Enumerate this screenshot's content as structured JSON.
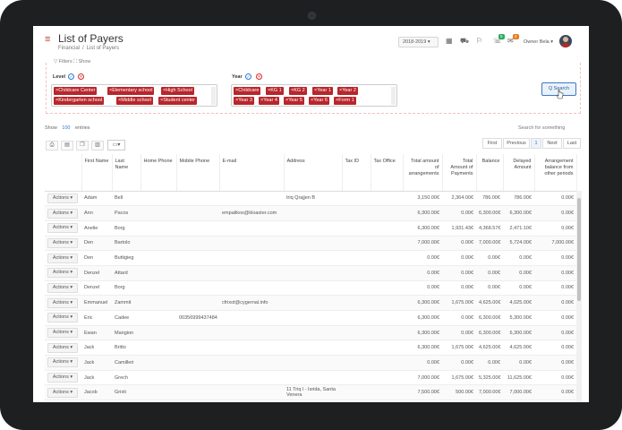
{
  "header": {
    "title": "List of Payers",
    "breadcrumb": [
      "Financial",
      "/",
      "List of Payers"
    ],
    "year": "2018-2019 ▾",
    "badge_notifications": "5",
    "badge_tasks": "4",
    "user_name": "Owner Bela ▾"
  },
  "filters": {
    "toggle_label": "▽ Filters ⛶ Show",
    "level": {
      "label": "Level",
      "tags": [
        "×Childcare Center",
        "×Elementary school",
        "×High School",
        "×Kindergarten school",
        "×Middle school",
        "×Student center"
      ]
    },
    "year": {
      "label": "Year",
      "tags": [
        "×Childcare",
        "×KG 1",
        "×KG 2",
        "×Year 1",
        "×Year 2",
        "×Year 3",
        "×Year 4",
        "×Year 5",
        "×Year 6",
        "×Form 1"
      ]
    },
    "search_button": "Q Search"
  },
  "list_controls": {
    "show_label": "Show",
    "show_count": "100",
    "entries_label": "entries",
    "search_label": "Search for something",
    "pager": [
      "First",
      "Previous",
      "1",
      "Next",
      "Last"
    ]
  },
  "table": {
    "headers": [
      "",
      "First Name",
      "Last Name",
      "Home Phone",
      "Mobile Phone",
      "E-mail",
      "Address",
      "Tax ID",
      "Tax Office",
      "Total amount of arrangements",
      "Total Amount of Payments",
      "Balance",
      "Delayed Amount",
      "Arrangement balance from other periods"
    ],
    "action_label": "Actions ▾",
    "rows": [
      [
        "Adam",
        "Bell",
        "",
        "",
        "",
        "triq Qrajjen B",
        "",
        "",
        "3,150.00€",
        "2,364.00€",
        "786.00€",
        "786.00€",
        "0.00€"
      ],
      [
        "Ann",
        "Pacos",
        "",
        "",
        "empalikos@kloaster.com",
        "",
        "",
        "",
        "6,300.00€",
        "0.00€",
        "6,300.00€",
        "6,300.00€",
        "0.00€"
      ],
      [
        "Anelie",
        "Borg",
        "",
        "",
        "",
        "",
        "",
        "",
        "6,300.00€",
        "1,931.43€",
        "4,368.57€",
        "2,471.10€",
        "0.00€"
      ],
      [
        "Den",
        "Bartolo",
        "",
        "",
        "",
        "",
        "",
        "",
        "7,000.00€",
        "0.00€",
        "7,000.00€",
        "5,724.00€",
        "7,000.00€"
      ],
      [
        "Den",
        "Buttigieg",
        "",
        "",
        "",
        "",
        "",
        "",
        "0.00€",
        "0.00€",
        "0.00€",
        "0.00€",
        "0.00€"
      ],
      [
        "Denzel",
        "Attard",
        "",
        "",
        "",
        "",
        "",
        "",
        "0.00€",
        "0.00€",
        "0.00€",
        "0.00€",
        "0.00€"
      ],
      [
        "Denzel",
        "Borg",
        "",
        "",
        "",
        "",
        "",
        "",
        "0.00€",
        "0.00€",
        "0.00€",
        "0.00€",
        "0.00€"
      ],
      [
        "Emmanuel",
        "Zammit",
        "",
        "",
        "cfrixot@cygernal.info",
        "",
        "",
        "",
        "6,300.00€",
        "1,675.00€",
        "4,625.00€",
        "4,025.00€",
        "0.00€"
      ],
      [
        "Eric",
        "Cadee",
        "",
        "00356999437484",
        "",
        "",
        "",
        "",
        "6,300.00€",
        "0.00€",
        "6,300.00€",
        "5,300.00€",
        "0.00€"
      ],
      [
        "Ewan",
        "Mangion",
        "",
        "",
        "",
        "",
        "",
        "",
        "6,300.00€",
        "0.00€",
        "6,300.00€",
        "6,300.00€",
        "0.00€"
      ],
      [
        "Jack",
        "Britto",
        "",
        "",
        "",
        "",
        "",
        "",
        "6,300.00€",
        "1,675.00€",
        "4,625.00€",
        "4,625.00€",
        "0.00€"
      ],
      [
        "Jack",
        "Camilleri",
        "",
        "",
        "",
        "",
        "",
        "",
        "0.00€",
        "0.00€",
        "0.00€",
        "0.00€",
        "0.00€"
      ],
      [
        "Jack",
        "Grech",
        "",
        "",
        "",
        "",
        "",
        "",
        "7,000.00€",
        "1,675.00€",
        "5,325.00€",
        "11,625.00€",
        "0.00€"
      ],
      [
        "Jacob",
        "Grixti",
        "",
        "",
        "",
        "11 Triq l - Isrida, Santa Venera",
        "",
        "",
        "7,500.00€",
        "500.00€",
        "7,000.00€",
        "7,000.00€",
        "0.00€"
      ]
    ]
  }
}
